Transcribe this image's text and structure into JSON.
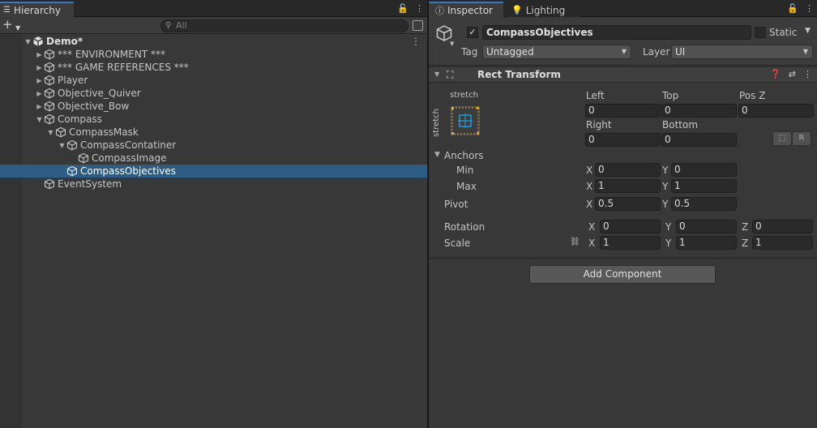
{
  "hierarchy": {
    "tab_label": "Hierarchy",
    "search_placeholder": "All",
    "scene": "Demo*",
    "items": [
      {
        "label": "*** ENVIRONMENT ***"
      },
      {
        "label": "*** GAME REFERENCES ***"
      },
      {
        "label": "Player"
      },
      {
        "label": "Objective_Quiver"
      },
      {
        "label": "Objective_Bow"
      },
      {
        "label": "Compass"
      },
      {
        "label": "CompassMask"
      },
      {
        "label": "CompassContatiner"
      },
      {
        "label": "CompassImage"
      },
      {
        "label": "CompassObjectives"
      },
      {
        "label": "EventSystem"
      }
    ]
  },
  "inspector": {
    "tab_label": "Inspector",
    "lighting_tab_label": "Lighting",
    "object_name": "CompassObjectives",
    "static_label": "Static",
    "tag_label": "Tag",
    "tag_value": "Untagged",
    "layer_label": "Layer",
    "layer_value": "UI",
    "component_title": "Rect Transform",
    "anchor_preset_top": "stretch",
    "anchor_preset_side": "stretch",
    "left_label": "Left",
    "left_value": "0",
    "top_label": "Top",
    "top_value": "0",
    "posz_label": "Pos Z",
    "posz_value": "0",
    "right_label": "Right",
    "right_value": "0",
    "bottom_label": "Bottom",
    "bottom_value": "0",
    "r_button": "R",
    "anchors_label": "Anchors",
    "min_label": "Min",
    "min_x": "0",
    "min_y": "0",
    "max_label": "Max",
    "max_x": "1",
    "max_y": "1",
    "pivot_label": "Pivot",
    "pivot_x": "0.5",
    "pivot_y": "0.5",
    "rotation_label": "Rotation",
    "rot_x": "0",
    "rot_y": "0",
    "rot_z": "0",
    "scale_label": "Scale",
    "scale_x": "1",
    "scale_y": "1",
    "scale_z": "1",
    "axis_x": "X",
    "axis_y": "Y",
    "axis_z": "Z",
    "add_component": "Add Component"
  },
  "colors": {
    "selection": "#2c5d87",
    "tab_accent": "#3a79bb",
    "anchor_blue": "#1e9bd7",
    "anchor_orange": "#e8a33b"
  }
}
